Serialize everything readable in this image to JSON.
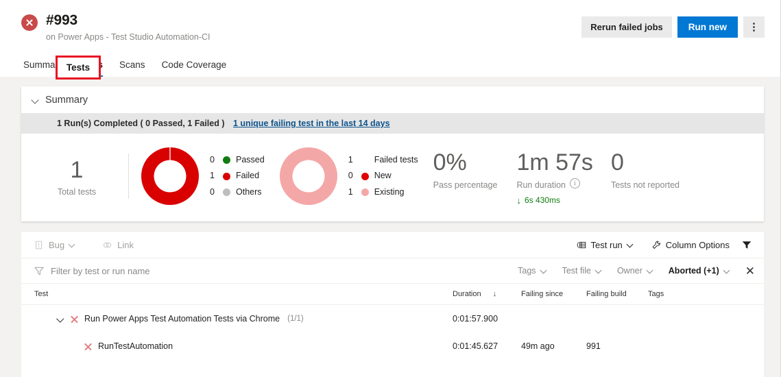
{
  "header": {
    "status_icon": "error-circle-icon",
    "build_number": "#993",
    "subtitle": "on Power Apps - Test Studio Automation-CI",
    "actions": {
      "rerun_label": "Rerun failed jobs",
      "run_new_label": "Run new",
      "more_label": "⋮"
    }
  },
  "tabs": [
    {
      "label": "Summary",
      "selected": false
    },
    {
      "label": "Tests",
      "selected": true
    },
    {
      "label": "Scans",
      "selected": false
    },
    {
      "label": "Code Coverage",
      "selected": false
    }
  ],
  "highlight": {
    "target": "Tests"
  },
  "summary": {
    "section_title": "Summary",
    "run_strip": "1 Run(s) Completed ( 0 Passed, 1 Failed )",
    "run_link": "1 unique failing test in the last 14 days",
    "total_tests": {
      "value": "1",
      "caption": "Total tests"
    },
    "outcome_legend": [
      {
        "count": "0",
        "label": "Passed",
        "color": "#107c10"
      },
      {
        "count": "1",
        "label": "Failed",
        "color": "#d90000"
      },
      {
        "count": "0",
        "label": "Others",
        "color": "#bebebe"
      }
    ],
    "failure_legend": [
      {
        "count": "1",
        "label": "Failed tests",
        "color": ""
      },
      {
        "count": "0",
        "label": "New",
        "color": "#e00000"
      },
      {
        "count": "1",
        "label": "Existing",
        "color": "#f4a7a7"
      }
    ],
    "pass_percentage": {
      "value": "0%",
      "caption": "Pass percentage"
    },
    "run_duration": {
      "value": "1m 57s",
      "caption": "Run duration",
      "info_icon": "info-icon",
      "delta_arrow": "↓",
      "delta": "6s 430ms",
      "delta_color": "#107c10"
    },
    "not_reported": {
      "value": "0",
      "caption": "Tests not reported"
    }
  },
  "toolbar": {
    "bug_label": "Bug",
    "link_label": "Link",
    "test_run_label": "Test run",
    "column_options_label": "Column Options",
    "filter_icon": "filter-funnel-icon"
  },
  "filterbar": {
    "search_placeholder": "Filter by test or run name",
    "pills": [
      {
        "label": "Tags",
        "active": false
      },
      {
        "label": "Test file",
        "active": false
      },
      {
        "label": "Owner",
        "active": false
      },
      {
        "label": "Aborted (+1)",
        "active": true
      }
    ],
    "clear_label": "✕"
  },
  "table": {
    "columns": [
      "Test",
      "Duration",
      "Failing since",
      "Failing build",
      "Tags"
    ],
    "sort": {
      "column": "Duration",
      "arrow": "↓"
    },
    "rows": [
      {
        "type": "group",
        "expanded": true,
        "name": "Run Power Apps Test Automation Tests via Chrome",
        "count": "(1/1)",
        "duration": "0:01:57.900",
        "failing_since": "",
        "failing_build": "",
        "tags": ""
      },
      {
        "type": "child",
        "name": "RunTestAutomation",
        "count": "",
        "duration": "0:01:45.627",
        "failing_since": "49m ago",
        "failing_build": "991",
        "tags": ""
      }
    ]
  },
  "colors": {
    "accent": "#0078d4",
    "fail_red": "#d90000",
    "fail_pink": "#f4a7a7",
    "pass_green": "#107c10",
    "highlight_red": "#e81123"
  }
}
